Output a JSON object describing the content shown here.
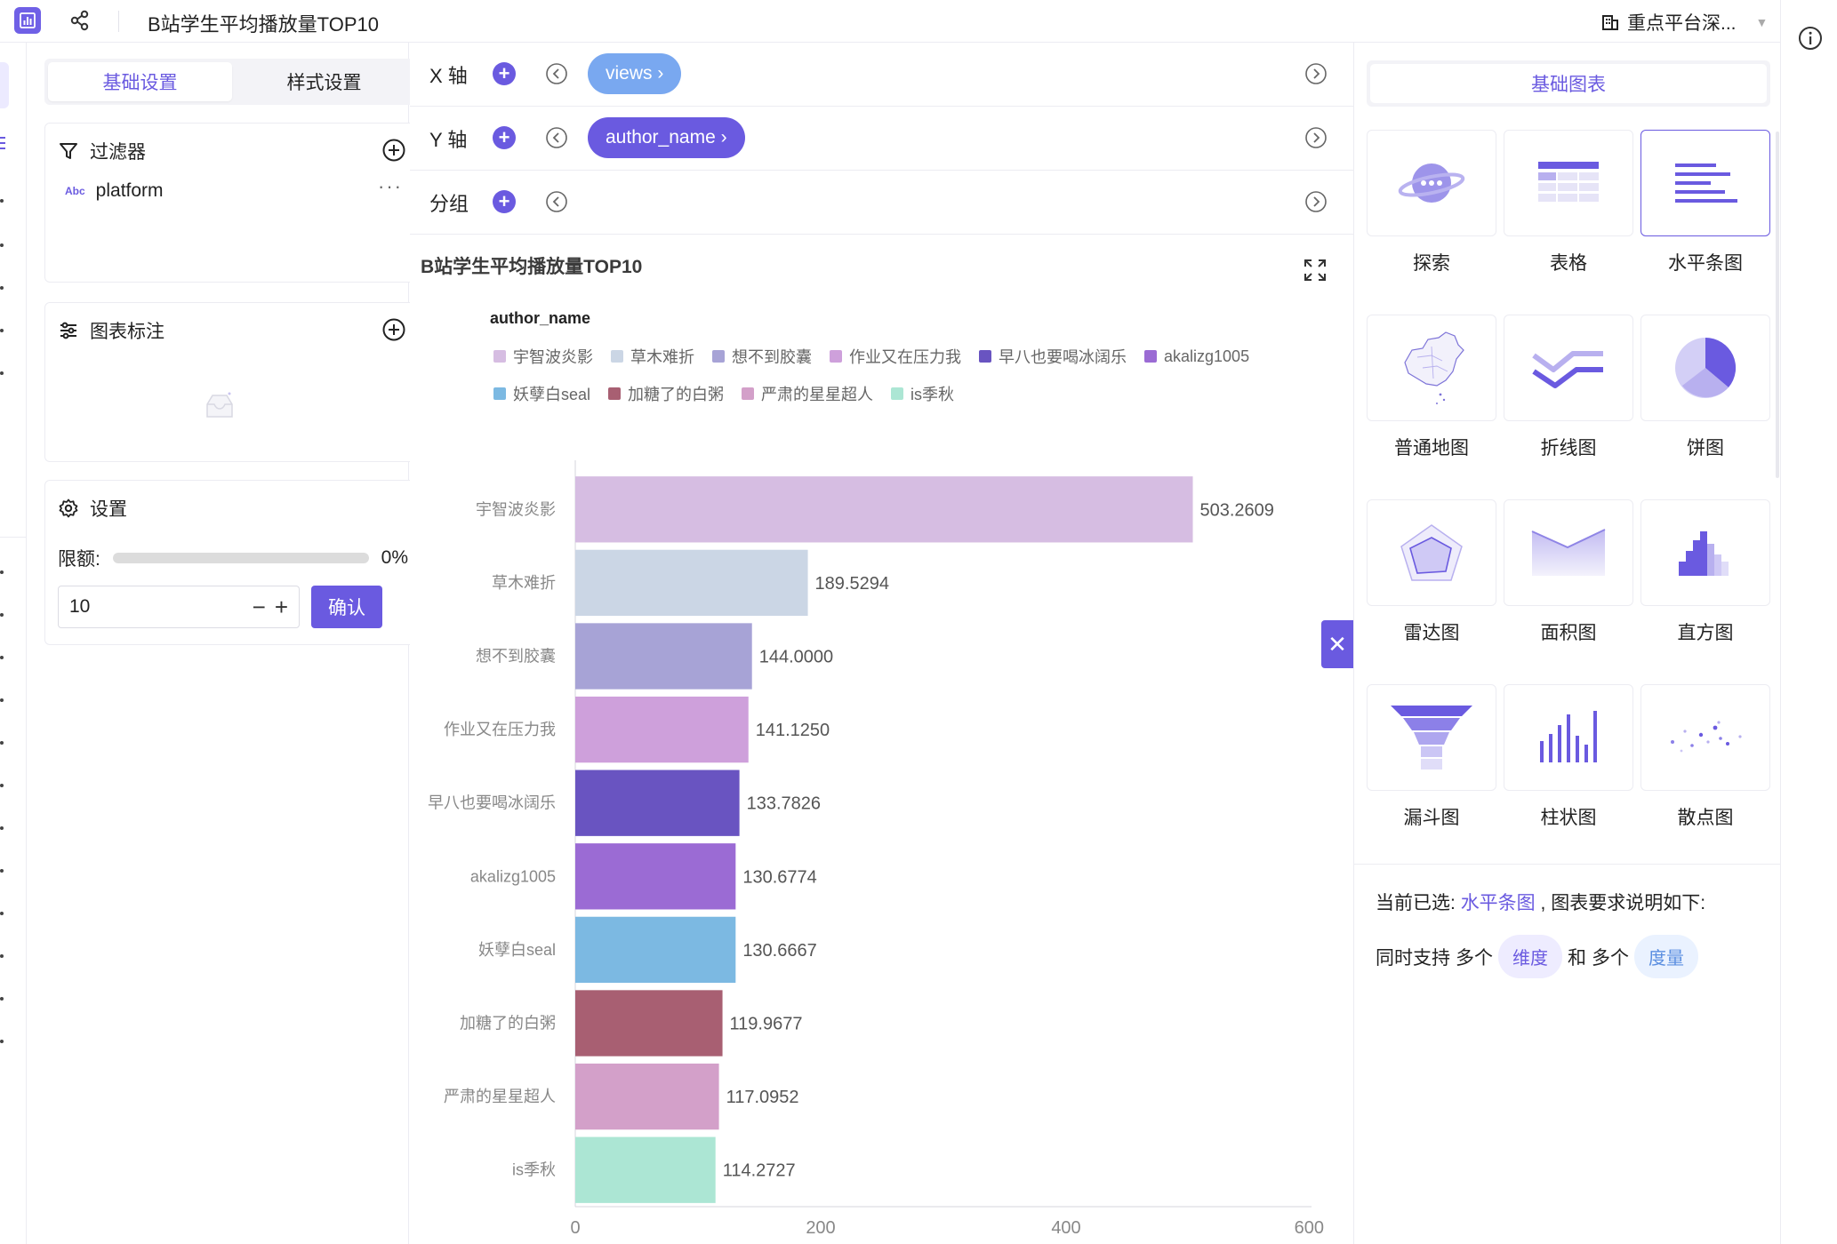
{
  "header": {
    "title": "B站学生平均播放量TOP10",
    "workspace": "重点平台深..."
  },
  "settings": {
    "tabs": [
      "基础设置",
      "样式设置"
    ],
    "filter": {
      "title": "过滤器",
      "field_type": "Abc",
      "field": "platform",
      "more": "···"
    },
    "annotation": {
      "title": "图表标注"
    },
    "config": {
      "title": "设置",
      "limit_label": "限额:",
      "limit_percent": "0%",
      "limit_fraction": 0,
      "count_value": "10",
      "minus": "−",
      "plus": "+",
      "confirm": "确认"
    }
  },
  "axes": {
    "x": {
      "label": "X 轴",
      "field": "views ›"
    },
    "y": {
      "label": "Y 轴",
      "field": "author_name ›"
    },
    "group": {
      "label": "分组"
    }
  },
  "chart": {
    "title": "B站学生平均播放量TOP10",
    "legend_title": "author_name",
    "close": "✕"
  },
  "chart_data": {
    "type": "bar",
    "orientation": "horizontal",
    "title": "B站学生平均播放量TOP10",
    "categories": [
      "宇智波炎影",
      "草木难折",
      "想不到胶囊",
      "作业又在压力我",
      "早八也要喝冰阔乐",
      "akalizg1005",
      "妖孽白seal",
      "加糖了的白粥",
      "严肃的星星超人",
      "is季秋"
    ],
    "values": [
      503.2609,
      189.5294,
      144.0,
      141.125,
      133.7826,
      130.6774,
      130.6667,
      119.9677,
      117.0952,
      114.2727
    ],
    "value_labels": [
      "503.2609",
      "189.5294",
      "144.0000",
      "141.1250",
      "133.7826",
      "130.6774",
      "130.6667",
      "119.9677",
      "117.0952",
      "114.2727"
    ],
    "colors": [
      "#d6bde2",
      "#cbd6e5",
      "#a7a3d6",
      "#cea0db",
      "#6954c1",
      "#9b6bd4",
      "#7cb9e2",
      "#a85f72",
      "#d3a0c9",
      "#ace6d4"
    ],
    "x_ticks": [
      "0",
      "200",
      "400",
      "600"
    ],
    "xlim": [
      0,
      600
    ],
    "legend": [
      "宇智波炎影",
      "草木难折",
      "想不到胶囊",
      "作业又在压力我",
      "早八也要喝冰阔乐",
      "akalizg1005",
      "妖孽白seal",
      "加糖了的白粥",
      "严肃的星星超人",
      "is季秋"
    ],
    "legend_placement": "top",
    "grid": false
  },
  "gallery": {
    "tab": "基础图表",
    "types": [
      {
        "label": "探索",
        "icon": "planet-icon"
      },
      {
        "label": "表格",
        "icon": "table-icon"
      },
      {
        "label": "水平条图",
        "icon": "horizontal-bar-icon",
        "selected": true
      },
      {
        "label": "普通地图",
        "icon": "china-map-icon"
      },
      {
        "label": "折线图",
        "icon": "line-chart-icon"
      },
      {
        "label": "饼图",
        "icon": "pie-chart-icon"
      },
      {
        "label": "雷达图",
        "icon": "radar-chart-icon"
      },
      {
        "label": "面积图",
        "icon": "area-chart-icon"
      },
      {
        "label": "直方图",
        "icon": "histogram-icon"
      },
      {
        "label": "漏斗图",
        "icon": "funnel-chart-icon"
      },
      {
        "label": "柱状图",
        "icon": "column-chart-icon"
      },
      {
        "label": "散点图",
        "icon": "scatter-chart-icon"
      }
    ],
    "desc": {
      "prefix": "当前已选:",
      "selected": "水平条图",
      "suffix": ", 图表要求说明如下:",
      "support": "同时支持",
      "many1": "多个",
      "dimension": "维度",
      "and": "和",
      "many2": "多个",
      "measure": "度量"
    }
  },
  "colors": {
    "accent": "#6a5ae0",
    "pill_light": "#79a8f0"
  }
}
